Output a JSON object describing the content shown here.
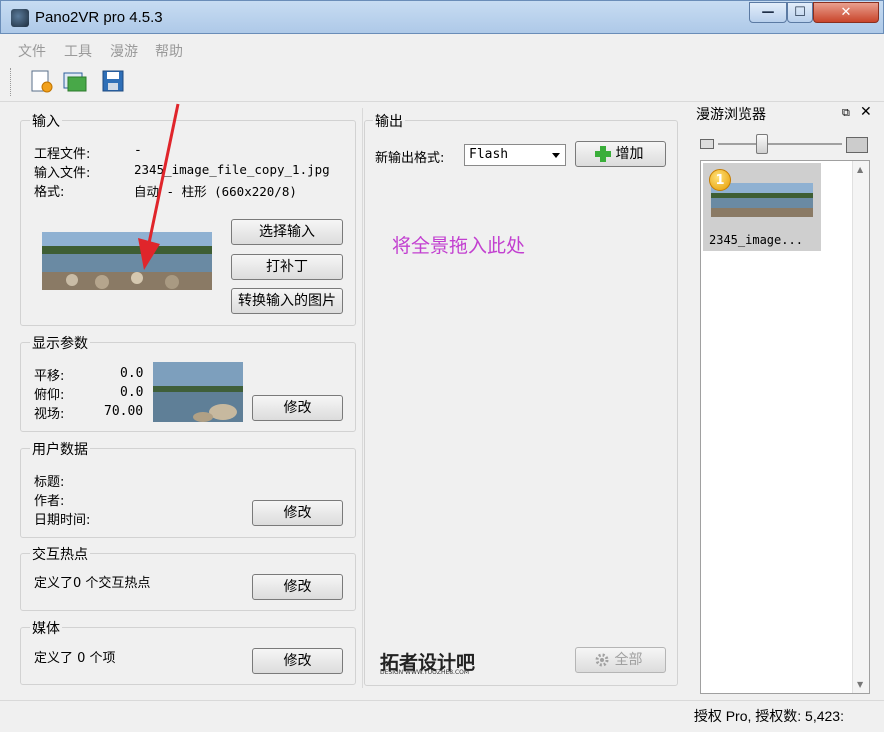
{
  "window": {
    "title": "Pano2VR pro 4.5.3",
    "minimize": "—",
    "maximize": "☐",
    "close": "✕"
  },
  "menu": [
    "文件",
    "工具",
    "漫游",
    "帮助"
  ],
  "toolbar": {
    "icons": [
      "new-project-icon",
      "open-project-icon",
      "save-icon"
    ]
  },
  "input": {
    "title": "输入",
    "project_file_label": "工程文件:",
    "project_file_value": "-",
    "input_file_label": "输入文件:",
    "input_file_value": "2345_image_file_copy_1.jpg",
    "format_label": "格式:",
    "format_value": "自动 - 柱形 (660x220/8)",
    "select_input": "选择输入",
    "patch": "打补丁",
    "convert": "转换输入的图片"
  },
  "display": {
    "title": "显示参数",
    "pan_label": "平移:",
    "pan_value": "0.0",
    "tilt_label": "俯仰:",
    "tilt_value": "0.0",
    "fov_label": "视场:",
    "fov_value": "70.00",
    "modify": "修改"
  },
  "userdata": {
    "title": "用户数据",
    "title_label": "标题:",
    "author_label": "作者:",
    "datetime_label": "日期时间:",
    "modify": "修改"
  },
  "hotspots": {
    "title": "交互热点",
    "text": "定义了0 个交互热点",
    "modify": "修改"
  },
  "media": {
    "title": "媒体",
    "text": "定义了 0 个项",
    "modify": "修改"
  },
  "output": {
    "title": "输出",
    "format_label": "新输出格式:",
    "format_value": "Flash",
    "add": "增加",
    "drop_hint": "将全景拖入此处",
    "all": "全部"
  },
  "browser": {
    "title": "漫游浏览器",
    "item_label": "2345_image...",
    "badge": "1"
  },
  "status": {
    "text": "授权 Pro, 授权数: 5,423:"
  },
  "watermark": {
    "text": "拓者设计吧",
    "sub": "DESIGN WWW.TUOZHE8.COM"
  }
}
